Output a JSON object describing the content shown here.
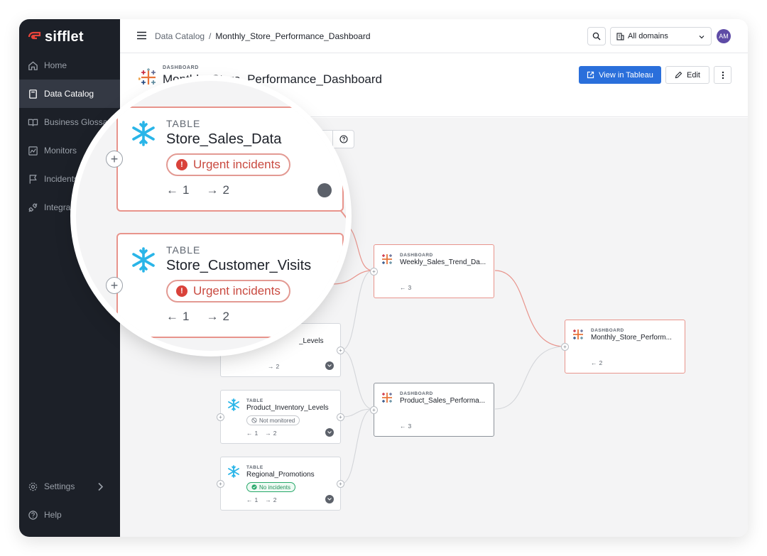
{
  "brand": {
    "name": "sifflet"
  },
  "sidebar": {
    "items": [
      {
        "label": "Home",
        "icon": "home-icon"
      },
      {
        "label": "Data Catalog",
        "icon": "book-icon"
      },
      {
        "label": "Business Glossary",
        "icon": "open-book-icon"
      },
      {
        "label": "Monitors",
        "icon": "monitor-chart-icon"
      },
      {
        "label": "Incidents",
        "icon": "flag-icon"
      },
      {
        "label": "Integratio",
        "icon": "plug-icon"
      }
    ],
    "bottom": [
      {
        "label": "Settings",
        "icon": "gear-icon"
      },
      {
        "label": "Help",
        "icon": "help-icon"
      }
    ]
  },
  "topbar": {
    "breadcrumb": [
      "Data Catalog",
      "/",
      "Monthly_Store_Performance_Dashboard"
    ],
    "domain_select": "All domains",
    "avatar_initials": "AM"
  },
  "header": {
    "kicker": "DASHBOARD",
    "title": "Monthly_Store_Performance_Dashboard",
    "view_button": "View in Tableau",
    "edit_button": "Edit"
  },
  "colors": {
    "accent": "#2a6fdb",
    "sidebar": "#1c2028",
    "alert": "#d9423a",
    "ok": "#27a86a"
  },
  "lineage": {
    "nodes": {
      "weekly": {
        "kicker": "DASHBOARD",
        "name": "Weekly_Sales_Trend_Da...",
        "up": "3"
      },
      "monthly": {
        "kicker": "DASHBOARD",
        "name": "Monthly_Store_Perform...",
        "up": "2"
      },
      "product_sales": {
        "kicker": "DASHBOARD",
        "name": "Product_Sales_Performa...",
        "up": "3"
      },
      "levels": {
        "name": "_Levels",
        "down": "2"
      },
      "inventory": {
        "kicker": "TABLE",
        "name": "Product_Inventory_Levels",
        "status": "Not monitored",
        "up": "1",
        "down": "2"
      },
      "promotions": {
        "kicker": "TABLE",
        "name": "Regional_Promotions",
        "status": "No incidents",
        "up": "1",
        "down": "2"
      }
    },
    "magnified": [
      {
        "kicker": "TABLE",
        "name": "Store_Sales_Data",
        "status": "Urgent incidents",
        "up": "1",
        "down": "2"
      },
      {
        "kicker": "TABLE",
        "name": "Store_Customer_Visits",
        "status": "Urgent incidents",
        "up": "1",
        "down": "2"
      }
    ]
  }
}
